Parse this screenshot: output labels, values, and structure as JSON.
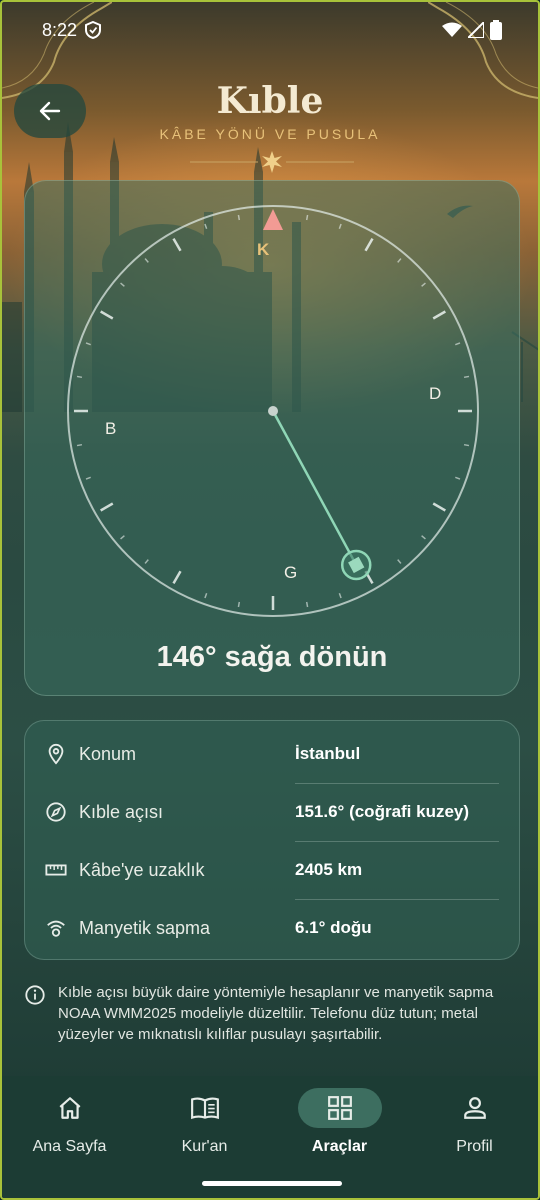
{
  "status_bar": {
    "time": "8:22",
    "icons": [
      "shield-icon",
      "wifi-icon",
      "signal-icon",
      "battery-icon"
    ]
  },
  "header": {
    "back_icon": "arrow-left-icon",
    "title": "Kıble",
    "subtitle": "KÂBE YÖNÜ VE PUSULA"
  },
  "compass": {
    "north": "K",
    "east": "D",
    "south": "G",
    "west": "B",
    "qibla_bearing": 151.6,
    "turn_instruction": "146° sağa dönün",
    "north_marker_color": "#f29b94",
    "needle_color": "#8fd6b6"
  },
  "info": {
    "rows": [
      {
        "icon": "location-pin-icon",
        "label": "Konum",
        "value": "İstanbul"
      },
      {
        "icon": "compass-icon",
        "label": "Kıble açısı",
        "value": "151.6° (coğrafi kuzey)"
      },
      {
        "icon": "ruler-icon",
        "label": "Kâbe'ye uzaklık",
        "value": "2405 km"
      },
      {
        "icon": "magnetic-signal-icon",
        "label": "Manyetik sapma",
        "value": "6.1° doğu"
      }
    ]
  },
  "note": {
    "icon": "info-icon",
    "text": "Kıble açısı büyük daire yöntemiyle hesaplanır ve manyetik sapma NOAA WMM2025 modeliyle düzeltilir. Telefonu düz tutun; metal yüzeyler ve mıknatıslı kılıflar pusulayı şaşırtabilir."
  },
  "nav": {
    "items": [
      {
        "label": "Ana Sayfa",
        "icon": "home-icon",
        "active": false
      },
      {
        "label": "Kur'an",
        "icon": "book-icon",
        "active": false
      },
      {
        "label": "Araçlar",
        "icon": "grid-icon",
        "active": true
      },
      {
        "label": "Profil",
        "icon": "person-icon",
        "active": false
      }
    ]
  },
  "colors": {
    "accent_gold": "#e8c27a",
    "card_green": "#3a6e5e",
    "nav_active": "#3d6e60"
  }
}
